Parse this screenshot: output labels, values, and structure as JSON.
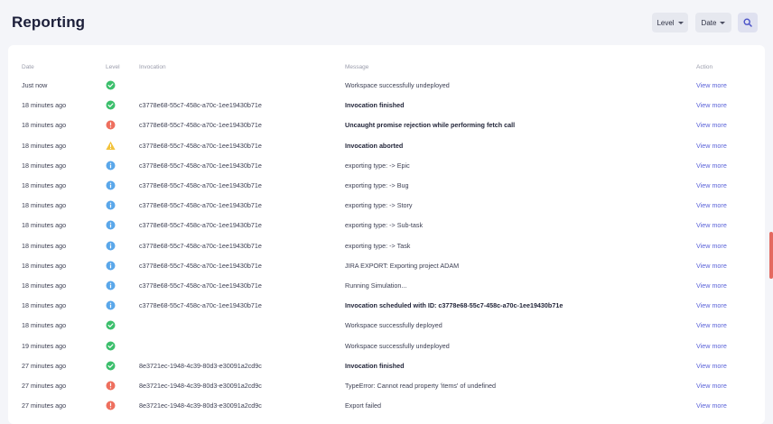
{
  "page": {
    "title": "Reporting"
  },
  "filters": {
    "level_label": "Level",
    "date_label": "Date"
  },
  "table": {
    "headers": {
      "date": "Date",
      "level": "Level",
      "invocation": "Invocation",
      "message": "Message",
      "action": "Action"
    },
    "rows": [
      {
        "date": "Just now",
        "level": "success",
        "invocation": "",
        "message": "Workspace successfully undeployed",
        "bold": false,
        "action": "View more"
      },
      {
        "date": "18 minutes ago",
        "level": "success",
        "invocation": "c3778e68-55c7-458c-a70c-1ee19430b71e",
        "message": "Invocation finished",
        "bold": true,
        "action": "View more"
      },
      {
        "date": "18 minutes ago",
        "level": "error",
        "invocation": "c3778e68-55c7-458c-a70c-1ee19430b71e",
        "message": "Uncaught promise rejection while performing fetch call",
        "bold": true,
        "action": "View more"
      },
      {
        "date": "18 minutes ago",
        "level": "warning",
        "invocation": "c3778e68-55c7-458c-a70c-1ee19430b71e",
        "message": "Invocation aborted",
        "bold": true,
        "action": "View more"
      },
      {
        "date": "18 minutes ago",
        "level": "info",
        "invocation": "c3778e68-55c7-458c-a70c-1ee19430b71e",
        "message": "exporting type: -> Epic",
        "bold": false,
        "action": "View more"
      },
      {
        "date": "18 minutes ago",
        "level": "info",
        "invocation": "c3778e68-55c7-458c-a70c-1ee19430b71e",
        "message": "exporting type: -> Bug",
        "bold": false,
        "action": "View more"
      },
      {
        "date": "18 minutes ago",
        "level": "info",
        "invocation": "c3778e68-55c7-458c-a70c-1ee19430b71e",
        "message": "exporting type: -> Story",
        "bold": false,
        "action": "View more"
      },
      {
        "date": "18 minutes ago",
        "level": "info",
        "invocation": "c3778e68-55c7-458c-a70c-1ee19430b71e",
        "message": "exporting type: -> Sub-task",
        "bold": false,
        "action": "View more"
      },
      {
        "date": "18 minutes ago",
        "level": "info",
        "invocation": "c3778e68-55c7-458c-a70c-1ee19430b71e",
        "message": "exporting type: -> Task",
        "bold": false,
        "action": "View more"
      },
      {
        "date": "18 minutes ago",
        "level": "info",
        "invocation": "c3778e68-55c7-458c-a70c-1ee19430b71e",
        "message": "JIRA EXPORT: Exporting project ADAM",
        "bold": false,
        "action": "View more"
      },
      {
        "date": "18 minutes ago",
        "level": "info",
        "invocation": "c3778e68-55c7-458c-a70c-1ee19430b71e",
        "message": "Running Simulation...",
        "bold": false,
        "action": "View more"
      },
      {
        "date": "18 minutes ago",
        "level": "info",
        "invocation": "c3778e68-55c7-458c-a70c-1ee19430b71e",
        "message": "Invocation scheduled with ID: c3778e68-55c7-458c-a70c-1ee19430b71e",
        "bold": true,
        "action": "View more"
      },
      {
        "date": "18 minutes ago",
        "level": "success",
        "invocation": "",
        "message": "Workspace successfully deployed",
        "bold": false,
        "action": "View more"
      },
      {
        "date": "19 minutes ago",
        "level": "success",
        "invocation": "",
        "message": "Workspace successfully undeployed",
        "bold": false,
        "action": "View more"
      },
      {
        "date": "27 minutes ago",
        "level": "success",
        "invocation": "8e3721ec-1948-4c39-80d3-e30091a2cd9c",
        "message": "Invocation finished",
        "bold": true,
        "action": "View more"
      },
      {
        "date": "27 minutes ago",
        "level": "error",
        "invocation": "8e3721ec-1948-4c39-80d3-e30091a2cd9c",
        "message": "TypeError: Cannot read property 'items' of undefined",
        "bold": false,
        "action": "View more"
      },
      {
        "date": "27 minutes ago",
        "level": "error",
        "invocation": "8e3721ec-1948-4c39-80d3-e30091a2cd9c",
        "message": "Export failed",
        "bold": false,
        "action": "View more"
      }
    ]
  },
  "colors": {
    "success": "#3cbf6c",
    "error": "#ee6f5e",
    "warning": "#f2c33b",
    "info": "#5aa7ea",
    "link": "#5b63d9"
  },
  "icons": {
    "search": "search-icon",
    "level_success": "check-circle-icon",
    "level_error": "error-circle-icon",
    "level_warning": "warning-triangle-icon",
    "level_info": "info-circle-icon"
  }
}
